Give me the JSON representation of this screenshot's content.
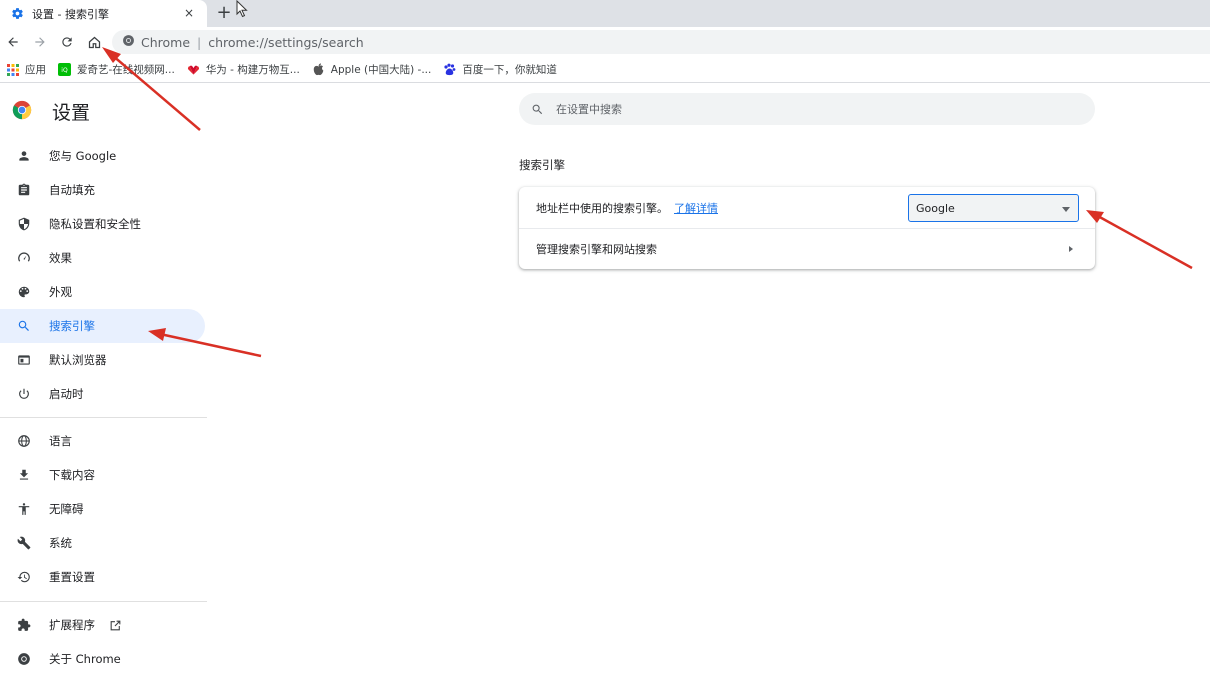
{
  "tab": {
    "title": "设置 - 搜索引擎",
    "close": "×",
    "new": "+"
  },
  "omnibox": {
    "site_label": "Chrome",
    "separator": "|",
    "url": "chrome://settings/search"
  },
  "bookmarks": [
    {
      "label": "应用",
      "icon": "apps-grid-icon"
    },
    {
      "label": "爱奇艺-在线视频网...",
      "icon": "iqiyi-icon"
    },
    {
      "label": "华为 - 构建万物互...",
      "icon": "huawei-icon"
    },
    {
      "label": "Apple (中国大陆) -...",
      "icon": "apple-icon"
    },
    {
      "label": "百度一下，你就知道",
      "icon": "baidu-icon"
    }
  ],
  "sidebar": {
    "title": "设置",
    "items": [
      {
        "label": "您与 Google",
        "icon": "person-icon"
      },
      {
        "label": "自动填充",
        "icon": "clipboard-icon"
      },
      {
        "label": "隐私设置和安全性",
        "icon": "shield-icon"
      },
      {
        "label": "效果",
        "icon": "speedometer-icon"
      },
      {
        "label": "外观",
        "icon": "palette-icon"
      },
      {
        "label": "搜索引擎",
        "icon": "search-icon"
      },
      {
        "label": "默认浏览器",
        "icon": "browser-icon"
      },
      {
        "label": "启动时",
        "icon": "power-icon"
      },
      {
        "label": "语言",
        "icon": "globe-icon"
      },
      {
        "label": "下载内容",
        "icon": "download-icon"
      },
      {
        "label": "无障碍",
        "icon": "accessibility-icon"
      },
      {
        "label": "系统",
        "icon": "wrench-icon"
      },
      {
        "label": "重置设置",
        "icon": "reset-icon"
      },
      {
        "label": "扩展程序",
        "icon": "puzzle-icon"
      },
      {
        "label": "关于 Chrome",
        "icon": "chrome-icon"
      }
    ]
  },
  "search": {
    "placeholder": "在设置中搜索"
  },
  "section": {
    "title": "搜索引擎",
    "row1_label": "地址栏中使用的搜索引擎。",
    "row1_link": "了解详情",
    "selected_engine": "Google",
    "row2_label": "管理搜索引擎和网站搜索"
  },
  "colors": {
    "accent": "#1a73e8",
    "annotation": "#d93025",
    "active_bg": "#e8f0fe"
  }
}
